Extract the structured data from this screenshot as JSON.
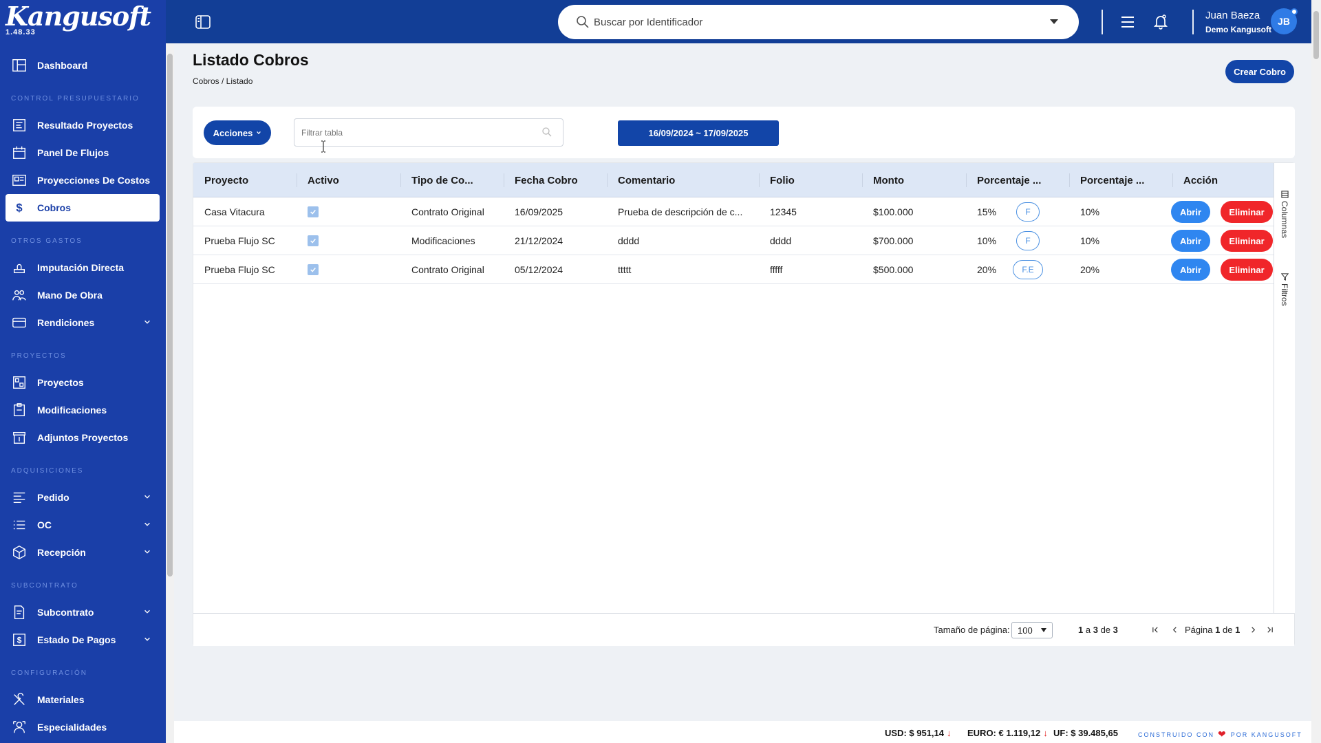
{
  "brand": {
    "name": "Kangusoft",
    "version": "1.48.33"
  },
  "sidebar": {
    "top": [
      {
        "label": "Dashboard",
        "icon": "dashboard-icon"
      }
    ],
    "sections": [
      {
        "title": "CONTROL PRESUPUESTARIO",
        "items": [
          {
            "label": "Resultado Proyectos",
            "icon": "report-icon"
          },
          {
            "label": "Panel De Flujos",
            "icon": "calendar-icon"
          },
          {
            "label": "Proyecciones De Costos",
            "icon": "projection-icon"
          },
          {
            "label": "Cobros",
            "icon": "dollar-icon",
            "active": true
          }
        ]
      },
      {
        "title": "OTROS GASTOS",
        "items": [
          {
            "label": "Imputación Directa",
            "icon": "stamp-icon"
          },
          {
            "label": "Mano De Obra",
            "icon": "workers-icon"
          },
          {
            "label": "Rendiciones",
            "icon": "card-icon",
            "expandable": true
          }
        ]
      },
      {
        "title": "PROYECTOS",
        "items": [
          {
            "label": "Proyectos",
            "icon": "project-icon"
          },
          {
            "label": "Modificaciones",
            "icon": "modification-icon"
          },
          {
            "label": "Adjuntos Proyectos",
            "icon": "archive-icon"
          }
        ]
      },
      {
        "title": "ADQUISICIONES",
        "items": [
          {
            "label": "Pedido",
            "icon": "order-list-icon",
            "expandable": true
          },
          {
            "label": "OC",
            "icon": "list-icon",
            "expandable": true
          },
          {
            "label": "Recepción",
            "icon": "box-icon",
            "expandable": true
          }
        ]
      },
      {
        "title": "SUBCONTRATO",
        "items": [
          {
            "label": "Subcontrato",
            "icon": "contract-icon",
            "expandable": true
          },
          {
            "label": "Estado De Pagos",
            "icon": "payment-icon",
            "expandable": true
          }
        ]
      },
      {
        "title": "CONFIGURACIÓN",
        "items": [
          {
            "label": "Materiales",
            "icon": "tools-icon"
          },
          {
            "label": "Especialidades",
            "icon": "specialist-icon"
          }
        ]
      }
    ]
  },
  "topbar": {
    "search_placeholder": "Buscar por Identificador",
    "user_name": "Juan Baeza",
    "user_org": "Demo Kangusoft",
    "avatar_initials": "JB"
  },
  "page": {
    "title": "Listado Cobros",
    "breadcrumb": "Cobros / Listado",
    "create_label": "Crear Cobro"
  },
  "toolbar": {
    "actions_label": "Acciones",
    "filter_placeholder": "Filtrar tabla",
    "date_range": "16/09/2024 ~ 17/09/2025"
  },
  "table": {
    "columns": [
      "Proyecto",
      "Activo",
      "Tipo de Co...",
      "Fecha Cobro",
      "Comentario",
      "Folio",
      "Monto",
      "Porcentaje ...",
      "Porcentaje ...",
      "Acción"
    ],
    "rows": [
      {
        "proyecto": "Casa Vitacura",
        "activo": true,
        "tipo": "Contrato Original",
        "fecha": "16/09/2025",
        "comentario": "Prueba de descripción de c...",
        "folio": "12345",
        "badge": "F",
        "monto": "$100.000",
        "pct1": "15%",
        "pct2": "10%"
      },
      {
        "proyecto": "Prueba Flujo SC",
        "activo": true,
        "tipo": "Modificaciones",
        "fecha": "21/12/2024",
        "comentario": "dddd",
        "folio": "dddd",
        "badge": "F",
        "monto": "$700.000",
        "pct1": "10%",
        "pct2": "10%"
      },
      {
        "proyecto": "Prueba Flujo SC",
        "activo": true,
        "tipo": "Contrato Original",
        "fecha": "05/12/2024",
        "comentario": "ttttt",
        "folio": "fffff",
        "badge": "F.E",
        "monto": "$500.000",
        "pct1": "20%",
        "pct2": "20%"
      }
    ],
    "open_label": "Abrir",
    "delete_label": "Eliminar",
    "side_tabs": {
      "columns": "Columnas",
      "filters": "Filtros"
    }
  },
  "pagination": {
    "page_size_label": "Tamaño de página:",
    "page_size": "100",
    "range_from": "1",
    "range_to": "3",
    "total": "3",
    "page_label": "Página",
    "page_current": "1",
    "page_total": "1",
    "a": "a",
    "de": "de"
  },
  "footer": {
    "usd": "USD: $ 951,14",
    "euro": "EURO: € 1.119,12",
    "uf": "UF: $ 39.485,65",
    "built_prefix": "CONSTRUIDO CON",
    "built_suffix": "POR KANGUSOFT"
  },
  "colors": {
    "sidebar": "#1a3fa8",
    "topbar": "#123e96",
    "primary": "#1245a8",
    "open": "#2f86f0",
    "delete": "#f0262a"
  }
}
